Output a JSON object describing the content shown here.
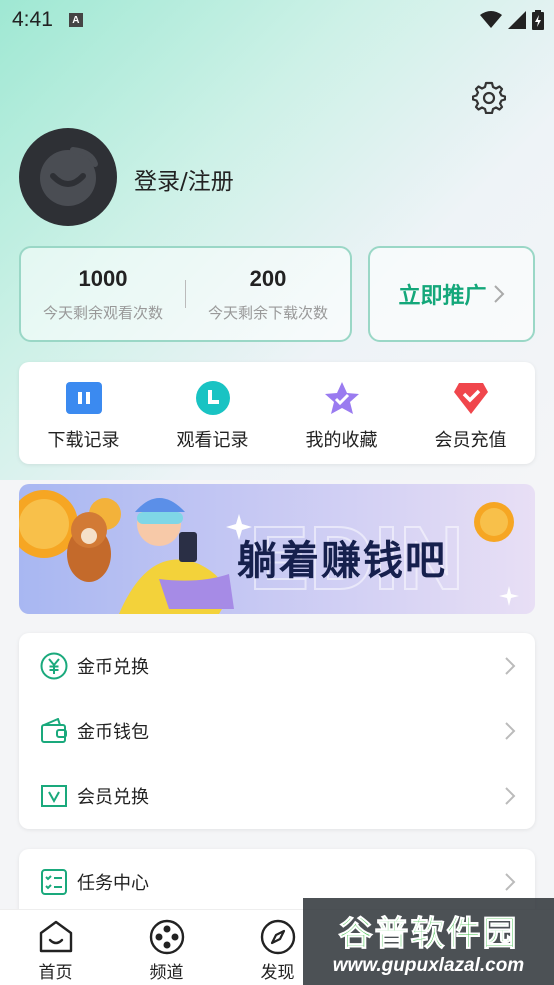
{
  "status_bar": {
    "time": "4:41",
    "notif_letter": "A"
  },
  "profile": {
    "login_label": "登录/注册"
  },
  "stats": [
    {
      "value": "1000",
      "label": "今天剩余观看次数"
    },
    {
      "value": "200",
      "label": "今天剩余下载次数"
    }
  ],
  "promo": {
    "label": "立即推广"
  },
  "quick_actions": [
    {
      "label": "下载记录",
      "icon": "download-icon",
      "color": "#3b8af0"
    },
    {
      "label": "观看记录",
      "icon": "history-icon",
      "color": "#19c3c3"
    },
    {
      "label": "我的收藏",
      "icon": "star-icon",
      "color": "#9a7bf0"
    },
    {
      "label": "会员充值",
      "icon": "diamond-icon",
      "color": "#f0464c"
    }
  ],
  "banner": {
    "text": "躺着赚钱吧"
  },
  "menu": [
    {
      "label": "金币兑换",
      "icon": "yen-coin-icon"
    },
    {
      "label": "金币钱包",
      "icon": "wallet-icon"
    },
    {
      "label": "会员兑换",
      "icon": "vip-icon"
    }
  ],
  "menu2": [
    {
      "label": "任务中心",
      "icon": "task-list-icon"
    }
  ],
  "bottom_nav": [
    {
      "label": "首页",
      "icon": "home-icon"
    },
    {
      "label": "频道",
      "icon": "film-reel-icon"
    },
    {
      "label": "发现",
      "icon": "compass-icon"
    }
  ],
  "watermark": {
    "title": "谷普软件园",
    "url": "www.gupuxlazal.com"
  },
  "colors": {
    "accent": "#14a77a",
    "border": "#9ad7c6"
  }
}
